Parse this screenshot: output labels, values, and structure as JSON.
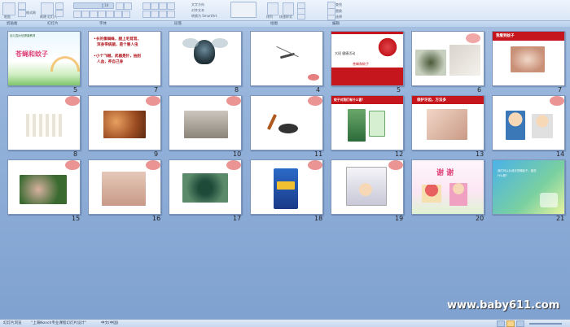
{
  "ribbon": {
    "groups": [
      "剪贴板",
      "幻灯片",
      "字体",
      "段落",
      "绘图",
      "编辑"
    ],
    "new_slide_label": "新建\n幻灯片",
    "paste_label": "粘贴",
    "font_size": "18",
    "format_painter": "格式刷",
    "direction_label": "文字方向",
    "align_label": "对齐文本",
    "smartart_label": "转换为 SmartArt",
    "arrange_label": "排列",
    "quick_styles_label": "快速样式",
    "find_label": "查找",
    "replace_label": "替换",
    "select_label": "选择"
  },
  "slides": [
    {
      "num": "5",
      "title": "苍蝇和蚊子",
      "subtitle": "幼儿园大班健康教育"
    },
    {
      "num": "7",
      "lines": [
        "•长的像蜘蛛，腿上毛茸茸，",
        "浑身带病菌，是个害人虫",
        "•小个飞贼，武器是针，抽别",
        "人血，养自己身"
      ]
    },
    {
      "num": "8"
    },
    {
      "num": "4"
    },
    {
      "num": "5",
      "header": "大班  健康活动",
      "caption": "苍蝇和蚊子"
    },
    {
      "num": "6"
    },
    {
      "num": "7",
      "header": "我看到蚊子"
    },
    {
      "num": "8"
    },
    {
      "num": "9"
    },
    {
      "num": "10"
    },
    {
      "num": "11"
    },
    {
      "num": "12",
      "header": "蚊子对我们有什么害？"
    },
    {
      "num": "13",
      "header": "保护牙齿，方法多"
    },
    {
      "num": "14"
    },
    {
      "num": "15"
    },
    {
      "num": "16"
    },
    {
      "num": "17"
    },
    {
      "num": "18"
    },
    {
      "num": "19"
    },
    {
      "num": "20",
      "title": "谢 谢"
    },
    {
      "num": "21",
      "header": "我们可以为消灭苍蝇蚊子，做些",
      "note": "什么呢？"
    }
  ],
  "status": {
    "slide_count": "幻灯片浏览",
    "theme": "\"上海Nonch专业课程幻灯片设计\"",
    "language": "中文(中国)"
  },
  "watermark": "www.baby611.com",
  "colors": {
    "accent_red": "#c4161c",
    "bg_blue": "#93b2da"
  }
}
